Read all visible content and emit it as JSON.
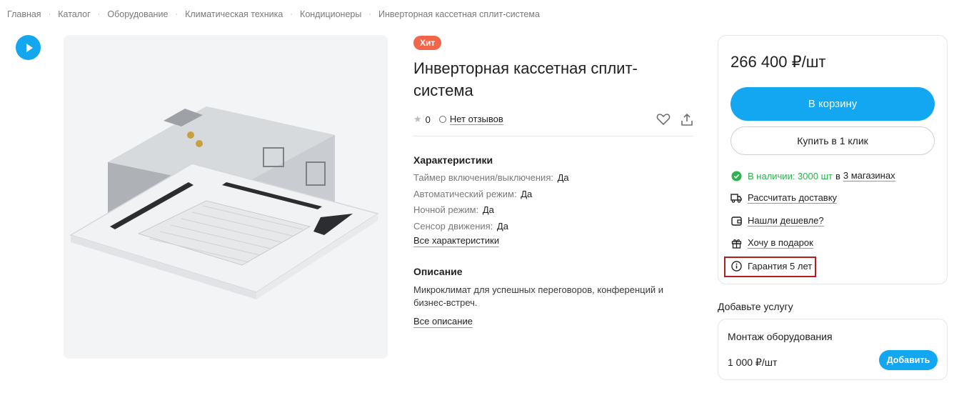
{
  "breadcrumb": [
    "Главная",
    "Каталог",
    "Оборудование",
    "Климатическая техника",
    "Кондиционеры",
    "Инверторная кассетная сплит-система"
  ],
  "breadcrumb_separator": "·",
  "product": {
    "badge": "Хит",
    "title": "Инверторная кассетная сплит-система",
    "rating": "0",
    "reviews_label": "Нет отзывов"
  },
  "characteristics": {
    "title": "Характеристики",
    "items": [
      {
        "label": "Таймер включения/выключения:",
        "value": "Да"
      },
      {
        "label": "Автоматический режим:",
        "value": "Да"
      },
      {
        "label": "Ночной режим:",
        "value": "Да"
      },
      {
        "label": "Сенсор движения:",
        "value": "Да"
      }
    ],
    "all_link": "Все характеристики"
  },
  "description": {
    "title": "Описание",
    "text": "Микроклимат для успешных переговоров, конференций и бизнес-встреч.",
    "all_link": "Все описание"
  },
  "buy": {
    "price": "266 400 ₽/шт",
    "cart_label": "В корзину",
    "one_click_label": "Купить в 1 клик",
    "stock_text": "В наличии: 3000 шт",
    "stock_in": "в",
    "stores_link": "3 магазинах",
    "delivery_link": "Рассчитать доставку",
    "cheaper_link": "Нашли дешевле?",
    "gift_link": "Хочу в подарок",
    "warranty": "Гарантия 5 лет"
  },
  "service": {
    "section_title": "Добавьте услугу",
    "name": "Монтаж оборудования",
    "price": "1 000 ₽/шт",
    "add_label": "Добавить"
  },
  "colors": {
    "accent": "#12a7f0",
    "badge": "#f2654a",
    "stock": "#2eb24f",
    "highlight": "#b91c1c"
  }
}
